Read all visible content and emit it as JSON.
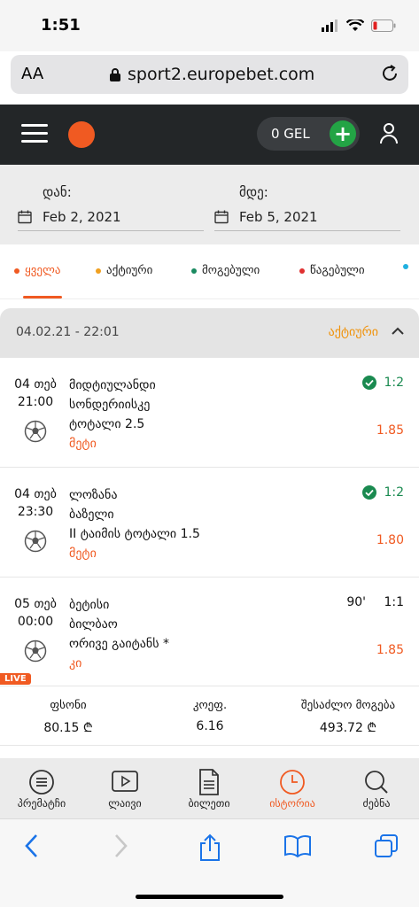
{
  "status_bar": {
    "time": "1:51"
  },
  "browser": {
    "aa_label": "AA",
    "url": "sport2.europebet.com"
  },
  "header": {
    "balance": "0 GEL",
    "add_symbol": "+",
    "brand_color": "#f05a22"
  },
  "date_filter": {
    "from_label": "დან:",
    "from_value": "Feb 2, 2021",
    "to_label": "მდე:",
    "to_value": "Feb 5, 2021"
  },
  "tabs": [
    {
      "label": "ყველა",
      "color": "#f05a22"
    },
    {
      "label": "აქტიური",
      "color": "#f0a020"
    },
    {
      "label": "მოგებული",
      "color": "#1a8a60"
    },
    {
      "label": "წაგებული",
      "color": "#e03030"
    }
  ],
  "bet": {
    "date": "04.02.21 - 22:01",
    "status": "აქტიური"
  },
  "events": [
    {
      "day": "04 თებ",
      "time": "21:00",
      "team1": "მიდტიულანდი",
      "team2": "სონდერიისკე",
      "market": "ტოტალი 2.5",
      "pick": "მეტი",
      "score": "1:2",
      "odds": "1.85"
    },
    {
      "day": "04 თებ",
      "time": "23:30",
      "team1": "ლოზანა",
      "team2": "ბაზელი",
      "market": "II ტაიმის ტოტალი 1.5",
      "pick": "მეტი",
      "score": "1:2",
      "odds": "1.80"
    },
    {
      "day": "05 თებ",
      "time": "00:00",
      "team1": "ბეტისი",
      "team2": "ბილბაო",
      "market": "ორივე გაიტანს *",
      "pick": "კი",
      "minute": "90'",
      "score": "1:1",
      "odds": "1.85",
      "live": "LIVE"
    }
  ],
  "summary": {
    "stake_label": "ფსონი",
    "stake_value": "80.15 ₾",
    "odds_label": "კოეფ.",
    "odds_value": "6.16",
    "win_label": "შესაძლო მოგება",
    "win_value": "493.72 ₾"
  },
  "nav": [
    {
      "label": "პრემატჩი",
      "icon": "menu-circle-icon"
    },
    {
      "label": "ლაივი",
      "icon": "play-icon"
    },
    {
      "label": "ბილეთი",
      "icon": "document-icon"
    },
    {
      "label": "ისტორია",
      "icon": "clock-icon",
      "active": true
    },
    {
      "label": "ძებნა",
      "icon": "search-icon"
    }
  ]
}
